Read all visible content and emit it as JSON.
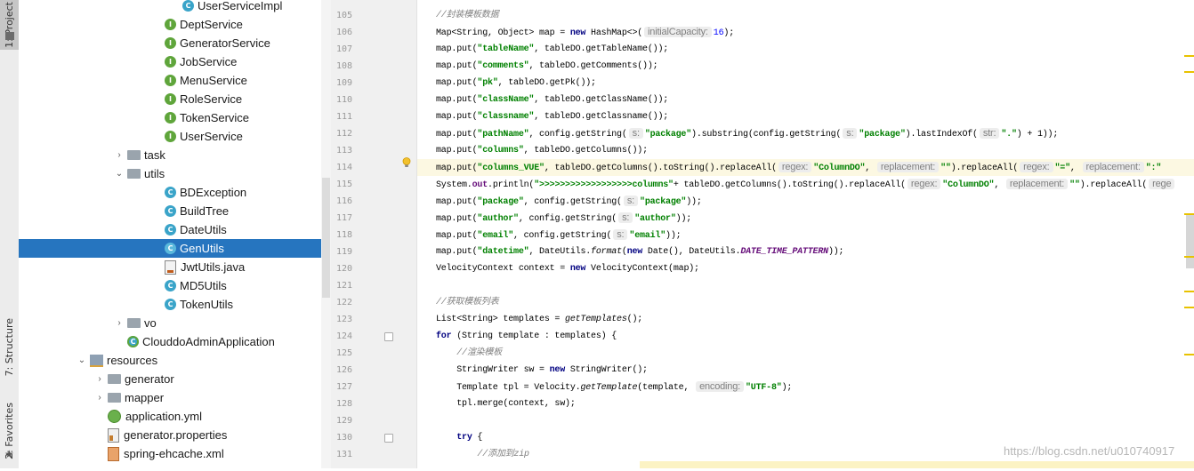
{
  "tool_tabs": {
    "project": "1: Project",
    "structure": "7: Structure",
    "favorites": "2: Favorites"
  },
  "tree": [
    {
      "label": "UserServiceImpl",
      "icon": "class-icon",
      "depth": 3,
      "arrow": ""
    },
    {
      "label": "DeptService",
      "icon": "interface-icon",
      "depth": 2,
      "arrow": ""
    },
    {
      "label": "GeneratorService",
      "icon": "interface-icon",
      "depth": 2,
      "arrow": ""
    },
    {
      "label": "JobService",
      "icon": "interface-icon",
      "depth": 2,
      "arrow": ""
    },
    {
      "label": "MenuService",
      "icon": "interface-icon",
      "depth": 2,
      "arrow": ""
    },
    {
      "label": "RoleService",
      "icon": "interface-icon",
      "depth": 2,
      "arrow": ""
    },
    {
      "label": "TokenService",
      "icon": "interface-icon",
      "depth": 2,
      "arrow": ""
    },
    {
      "label": "UserService",
      "icon": "interface-icon",
      "depth": 2,
      "arrow": ""
    },
    {
      "label": "task",
      "icon": "folder-icon",
      "depth": 1,
      "arrow": "›"
    },
    {
      "label": "utils",
      "icon": "folder-icon",
      "depth": 1,
      "arrow": "⌄"
    },
    {
      "label": "BDException",
      "icon": "class-icon",
      "depth": 2,
      "arrow": ""
    },
    {
      "label": "BuildTree",
      "icon": "class-icon",
      "depth": 2,
      "arrow": ""
    },
    {
      "label": "DateUtils",
      "icon": "class-icon",
      "depth": 2,
      "arrow": ""
    },
    {
      "label": "GenUtils",
      "icon": "class-icon",
      "depth": 2,
      "arrow": "",
      "selected": true
    },
    {
      "label": "JwtUtils.java",
      "icon": "java-file-icon",
      "depth": 2,
      "arrow": ""
    },
    {
      "label": "MD5Utils",
      "icon": "class-icon",
      "depth": 2,
      "arrow": ""
    },
    {
      "label": "TokenUtils",
      "icon": "class-icon",
      "depth": 2,
      "arrow": ""
    },
    {
      "label": "vo",
      "icon": "folder-icon",
      "depth": 1,
      "arrow": "›"
    },
    {
      "label": "ClouddoAdminApplication",
      "icon": "spring-main-icon",
      "depth": 1,
      "arrow": ""
    },
    {
      "label": "resources",
      "icon": "resources-folder-icon",
      "depth": 0,
      "arrow": "⌄"
    },
    {
      "label": "generator",
      "icon": "folder-icon",
      "depth": 0.5,
      "arrow": "›"
    },
    {
      "label": "mapper",
      "icon": "folder-icon",
      "depth": 0.5,
      "arrow": "›"
    },
    {
      "label": "application.yml",
      "icon": "yml-file-icon",
      "depth": 0.5,
      "arrow": ""
    },
    {
      "label": "generator.properties",
      "icon": "properties-file-icon",
      "depth": 0.5,
      "arrow": ""
    },
    {
      "label": "spring-ehcache.xml",
      "icon": "xml-file-icon",
      "depth": 0.5,
      "arrow": ""
    }
  ],
  "line_numbers": [
    "105",
    "106",
    "107",
    "108",
    "109",
    "110",
    "111",
    "112",
    "113",
    "114",
    "115",
    "116",
    "117",
    "118",
    "119",
    "120",
    "121",
    "122",
    "123",
    "124",
    "125",
    "126",
    "127",
    "128",
    "129",
    "130",
    "131"
  ],
  "code": [
    [
      {
        "t": "//封装模板数据",
        "c": "cm"
      }
    ],
    [
      {
        "t": "Map<String, Object> map = "
      },
      {
        "t": "new",
        "c": "kw"
      },
      {
        "t": " HashMap<>("
      },
      {
        "t": "initialCapacity:",
        "c": "hint"
      },
      {
        "t": "16",
        "c": "num"
      },
      {
        "t": ");"
      }
    ],
    [
      {
        "t": "map.put("
      },
      {
        "t": "\"tableName\"",
        "c": "str"
      },
      {
        "t": ", tableDO.getTableName());"
      }
    ],
    [
      {
        "t": "map.put("
      },
      {
        "t": "\"comments\"",
        "c": "str"
      },
      {
        "t": ", tableDO.getComments());"
      }
    ],
    [
      {
        "t": "map.put("
      },
      {
        "t": "\"pk\"",
        "c": "str"
      },
      {
        "t": ", tableDO.getPk());"
      }
    ],
    [
      {
        "t": "map.put("
      },
      {
        "t": "\"className\"",
        "c": "str"
      },
      {
        "t": ", tableDO.getClassName());"
      }
    ],
    [
      {
        "t": "map.put("
      },
      {
        "t": "\"classname\"",
        "c": "str"
      },
      {
        "t": ", tableDO.getClassname());"
      }
    ],
    [
      {
        "t": "map.put("
      },
      {
        "t": "\"pathName\"",
        "c": "str"
      },
      {
        "t": ", config.getString("
      },
      {
        "t": "s:",
        "c": "hint"
      },
      {
        "t": "\"package\"",
        "c": "str"
      },
      {
        "t": ").substring(config.getString("
      },
      {
        "t": "s:",
        "c": "hint"
      },
      {
        "t": "\"package\"",
        "c": "str"
      },
      {
        "t": ").lastIndexOf("
      },
      {
        "t": "str:",
        "c": "hint"
      },
      {
        "t": "\".\"",
        "c": "str"
      },
      {
        "t": ") + 1));"
      }
    ],
    [
      {
        "t": "map.put("
      },
      {
        "t": "\"columns\"",
        "c": "str"
      },
      {
        "t": ", tableDO.getColumns());"
      }
    ],
    [
      {
        "t": "map.put("
      },
      {
        "t": "\"columns_VUE\"",
        "c": "str"
      },
      {
        "t": ", tableDO.getColumns().toString().replaceAll("
      },
      {
        "t": "regex:",
        "c": "hint"
      },
      {
        "t": "\"ColumnDO\"",
        "c": "str"
      },
      {
        "t": ", "
      },
      {
        "t": "replacement:",
        "c": "hint"
      },
      {
        "t": "\"\"",
        "c": "str"
      },
      {
        "t": ").replaceAll("
      },
      {
        "t": "regex:",
        "c": "hint"
      },
      {
        "t": "\"=\"",
        "c": "str"
      },
      {
        "t": ", "
      },
      {
        "t": "replacement:",
        "c": "hint"
      },
      {
        "t": "\":\"",
        "c": "str"
      }
    ],
    [
      {
        "t": "System."
      },
      {
        "t": "out",
        "c": "fld"
      },
      {
        "t": ".println("
      },
      {
        "t": "\">>>>>>>>>>>>>>>>>>columns\"",
        "c": "str"
      },
      {
        "t": "+ tableDO.getColumns().toString().replaceAll("
      },
      {
        "t": "regex:",
        "c": "hint"
      },
      {
        "t": "\"ColumnDO\"",
        "c": "str"
      },
      {
        "t": ", "
      },
      {
        "t": "replacement:",
        "c": "hint"
      },
      {
        "t": "\"\"",
        "c": "str"
      },
      {
        "t": ").replaceAll("
      },
      {
        "t": "rege",
        "c": "hint"
      }
    ],
    [
      {
        "t": "map.put("
      },
      {
        "t": "\"package\"",
        "c": "str"
      },
      {
        "t": ", config.getString("
      },
      {
        "t": "s:",
        "c": "hint"
      },
      {
        "t": "\"package\"",
        "c": "str"
      },
      {
        "t": "));"
      }
    ],
    [
      {
        "t": "map.put("
      },
      {
        "t": "\"author\"",
        "c": "str"
      },
      {
        "t": ", config.getString("
      },
      {
        "t": "s:",
        "c": "hint"
      },
      {
        "t": "\"author\"",
        "c": "str"
      },
      {
        "t": "));"
      }
    ],
    [
      {
        "t": "map.put("
      },
      {
        "t": "\"email\"",
        "c": "str"
      },
      {
        "t": ", config.getString("
      },
      {
        "t": "s:",
        "c": "hint"
      },
      {
        "t": "\"email\"",
        "c": "str"
      },
      {
        "t": "));"
      }
    ],
    [
      {
        "t": "map.put("
      },
      {
        "t": "\"datetime\"",
        "c": "str"
      },
      {
        "t": ", DateUtils."
      },
      {
        "t": "format",
        "c": "it"
      },
      {
        "t": "("
      },
      {
        "t": "new",
        "c": "kw"
      },
      {
        "t": " Date(), DateUtils."
      },
      {
        "t": "DATE_TIME_PATTERN",
        "c": "stat"
      },
      {
        "t": "));"
      }
    ],
    [
      {
        "t": "VelocityContext context = "
      },
      {
        "t": "new",
        "c": "kw"
      },
      {
        "t": " VelocityContext(map);"
      }
    ],
    [],
    [
      {
        "t": "//获取模板列表",
        "c": "cm"
      }
    ],
    [
      {
        "t": "List<String> templates = "
      },
      {
        "t": "getTemplates",
        "c": "it"
      },
      {
        "t": "();"
      }
    ],
    [
      {
        "t": "for",
        "c": "kw"
      },
      {
        "t": " (String template : templates) {"
      }
    ],
    [
      {
        "t": "    "
      },
      {
        "t": "//渲染模板",
        "c": "cm"
      }
    ],
    [
      {
        "t": "    StringWriter sw = "
      },
      {
        "t": "new",
        "c": "kw"
      },
      {
        "t": " StringWriter();"
      }
    ],
    [
      {
        "t": "    Template tpl = Velocity."
      },
      {
        "t": "getTemplate",
        "c": "it"
      },
      {
        "t": "(template, "
      },
      {
        "t": "encoding:",
        "c": "hint"
      },
      {
        "t": "\"UTF-8\"",
        "c": "str"
      },
      {
        "t": ");"
      }
    ],
    [
      {
        "t": "    tpl.merge(context, sw);"
      }
    ],
    [],
    [
      {
        "t": "    "
      },
      {
        "t": "try",
        "c": "kw"
      },
      {
        "t": " {"
      }
    ],
    [
      {
        "t": "        "
      },
      {
        "t": "//添加到zip",
        "c": "cm"
      }
    ]
  ],
  "watermark": "https://blog.csdn.net/u010740917",
  "colors": {
    "selection": "#2675bf",
    "current_line": "#fcf8e2",
    "keyword": "#000080",
    "string": "#008000",
    "comment": "#808080"
  }
}
